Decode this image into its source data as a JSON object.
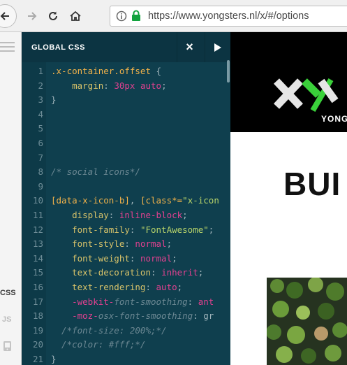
{
  "browser": {
    "url": "https://www.yongsters.nl/x/#/options",
    "icons": [
      "back-icon",
      "forward-icon",
      "reload-icon",
      "home-icon",
      "info-icon",
      "lock-icon"
    ]
  },
  "rail": {
    "tabs": [
      {
        "label": "CSS",
        "active": true
      },
      {
        "label": "JS",
        "active": false
      }
    ]
  },
  "panel": {
    "title": "GLOBAL CSS",
    "close_glyph": "×"
  },
  "code": {
    "lines": [
      {
        "n": "1",
        "tokens": [
          [
            ".x-container.offset",
            "sel"
          ],
          [
            " {",
            "pun"
          ]
        ]
      },
      {
        "n": "2",
        "tokens": [
          [
            "    margin",
            "prop"
          ],
          [
            ": ",
            "pun"
          ],
          [
            "30px auto",
            "val"
          ],
          [
            ";",
            "pun"
          ]
        ]
      },
      {
        "n": "3",
        "tokens": [
          [
            "}",
            "pun"
          ]
        ]
      },
      {
        "n": "4",
        "tokens": []
      },
      {
        "n": "5",
        "tokens": []
      },
      {
        "n": "6",
        "tokens": []
      },
      {
        "n": "7",
        "tokens": []
      },
      {
        "n": "8",
        "tokens": [
          [
            "/* social icons*/",
            "com"
          ]
        ]
      },
      {
        "n": "9",
        "tokens": []
      },
      {
        "n": "10",
        "tokens": [
          [
            "[data-x-icon-b]",
            "sel"
          ],
          [
            ", ",
            "pun"
          ],
          [
            "[class*=",
            "sel"
          ],
          [
            "\"x-icon",
            "str"
          ]
        ]
      },
      {
        "n": "11",
        "tokens": [
          [
            "    display",
            "prop"
          ],
          [
            ": ",
            "pun"
          ],
          [
            "inline-block",
            "val"
          ],
          [
            ";",
            "pun"
          ]
        ]
      },
      {
        "n": "12",
        "tokens": [
          [
            "    font-family",
            "prop"
          ],
          [
            ": ",
            "pun"
          ],
          [
            "\"FontAwesome\"",
            "str"
          ],
          [
            ";",
            "pun"
          ]
        ]
      },
      {
        "n": "13",
        "tokens": [
          [
            "    font-style",
            "prop"
          ],
          [
            ": ",
            "pun"
          ],
          [
            "normal",
            "val"
          ],
          [
            ";",
            "pun"
          ]
        ]
      },
      {
        "n": "14",
        "tokens": [
          [
            "    font-weight",
            "prop"
          ],
          [
            ": ",
            "pun"
          ],
          [
            "normal",
            "val"
          ],
          [
            ";",
            "pun"
          ]
        ]
      },
      {
        "n": "15",
        "tokens": [
          [
            "    text-decoration",
            "prop"
          ],
          [
            ": ",
            "pun"
          ],
          [
            "inherit",
            "val"
          ],
          [
            ";",
            "pun"
          ]
        ]
      },
      {
        "n": "16",
        "tokens": [
          [
            "    text-rendering",
            "prop"
          ],
          [
            ": ",
            "pun"
          ],
          [
            "auto",
            "val"
          ],
          [
            ";",
            "pun"
          ]
        ]
      },
      {
        "n": "17",
        "tokens": [
          [
            "    -webkit-",
            "val"
          ],
          [
            "font-smoothing",
            "com"
          ],
          [
            ": ",
            "pun"
          ],
          [
            "ant",
            "val"
          ]
        ]
      },
      {
        "n": "18",
        "tokens": [
          [
            "    -moz-",
            "val"
          ],
          [
            "osx-font-smoothing",
            "com"
          ],
          [
            ": ",
            "pun"
          ],
          [
            "gr",
            "pun"
          ]
        ]
      },
      {
        "n": "19",
        "tokens": [
          [
            "  /*font-size: 200%;*/",
            "com"
          ]
        ]
      },
      {
        "n": "20",
        "tokens": [
          [
            "  /*color: #fff;*/",
            "com"
          ]
        ]
      },
      {
        "n": "21",
        "tokens": [
          [
            "}",
            "pun"
          ]
        ]
      }
    ]
  },
  "preview": {
    "logo_text": "YONG",
    "headline": "BUI"
  },
  "colors": {
    "panel_bg": "#0f3f4e",
    "accent_green": "#3ad13a"
  }
}
